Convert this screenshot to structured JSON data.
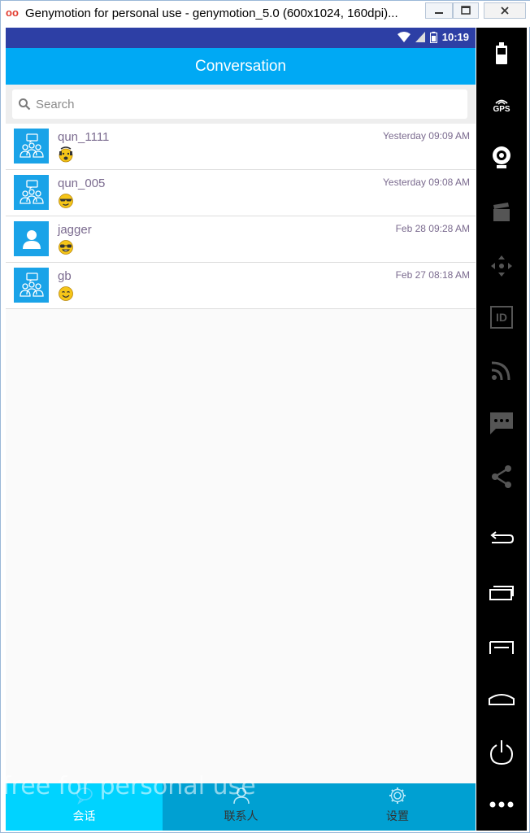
{
  "window": {
    "title": "Genymotion for personal use - genymotion_5.0 (600x1024, 160dpi)...",
    "logo": "oo"
  },
  "statusbar": {
    "time": "10:19"
  },
  "appbar": {
    "title": "Conversation"
  },
  "search": {
    "placeholder": "Search"
  },
  "conversations": [
    {
      "name": "qun_1111",
      "time": "Yesterday 09:09 AM",
      "avatar": "group",
      "emoji": "crying-face"
    },
    {
      "name": "qun_005",
      "time": "Yesterday 09:08 AM",
      "avatar": "group",
      "emoji": "cool-face"
    },
    {
      "name": "jagger",
      "time": "Feb 28 09:28 AM",
      "avatar": "person",
      "emoji": "sunglasses-face"
    },
    {
      "name": "gb",
      "time": "Feb 27 08:18 AM",
      "avatar": "group",
      "emoji": "smiling-face"
    }
  ],
  "bottomnav": {
    "tabs": [
      {
        "label": "会话",
        "icon": "chat-icon",
        "active": true
      },
      {
        "label": "联系人",
        "icon": "person-icon",
        "active": false
      },
      {
        "label": "设置",
        "icon": "gear-icon",
        "active": false
      }
    ]
  },
  "watermark": "free for personal use",
  "sidebar": {
    "buttons": [
      "battery-icon",
      "gps-icon",
      "webcam-icon",
      "video-icon",
      "dpad-icon",
      "id-icon",
      "cast-icon",
      "sms-icon",
      "share-icon",
      "back-icon",
      "recent-apps-icon",
      "menu-icon",
      "home-icon",
      "power-icon",
      "more-icon"
    ],
    "gps_label": "GPS",
    "id_label": "ID"
  },
  "colors": {
    "statusbar": "#2d3fa5",
    "appbar": "#00a9f4",
    "nav": "#00a0d2",
    "nav_active": "#00d3ff",
    "avatar": "#1aa3e8",
    "name_text": "#7b6b8f"
  }
}
